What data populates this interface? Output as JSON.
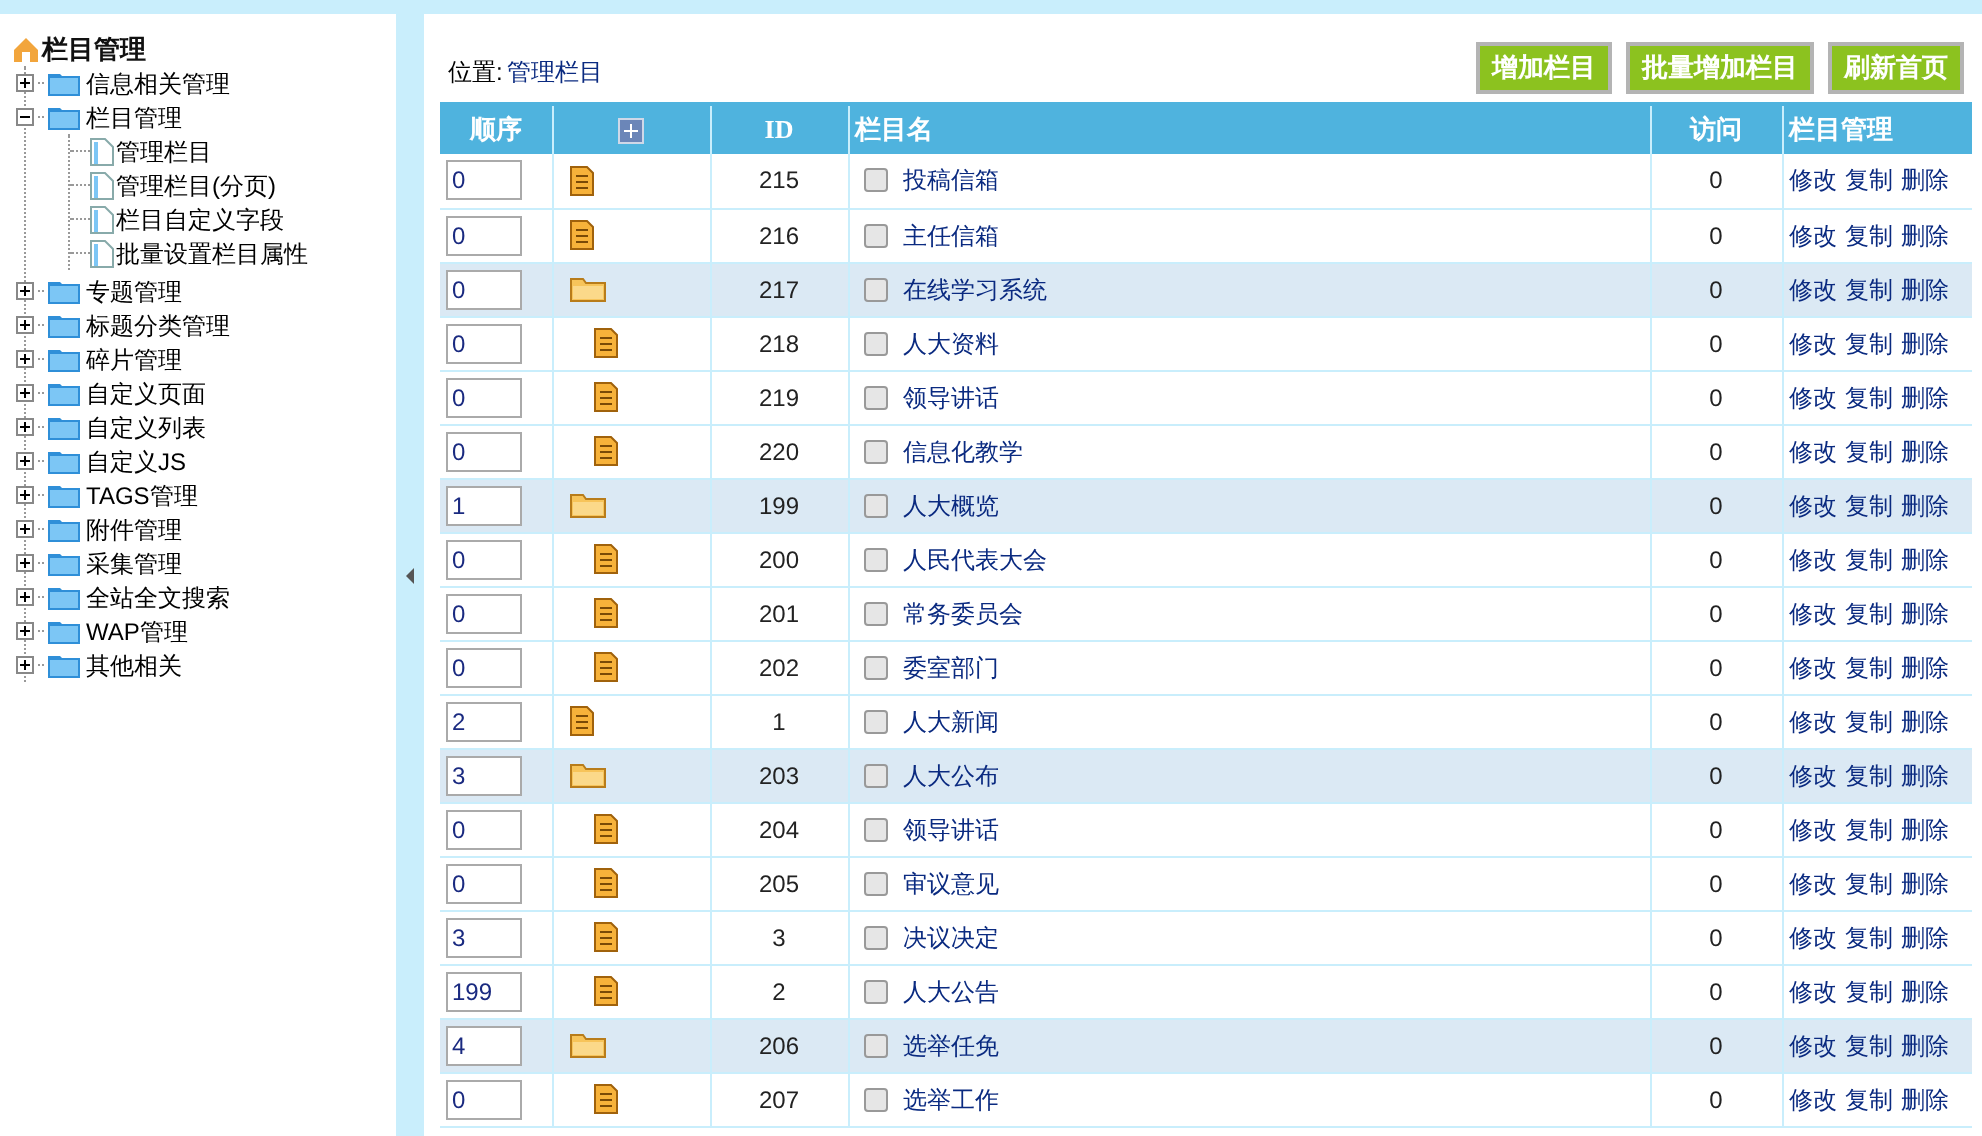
{
  "sidebar": {
    "title": "栏目管理",
    "items": [
      {
        "label": "信息相关管理",
        "expanded": false
      },
      {
        "label": "栏目管理",
        "expanded": true,
        "children": [
          {
            "label": "管理栏目"
          },
          {
            "label": "管理栏目(分页)"
          },
          {
            "label": "栏目自定义字段"
          },
          {
            "label": "批量设置栏目属性"
          }
        ]
      },
      {
        "label": "专题管理",
        "expanded": false
      },
      {
        "label": "标题分类管理",
        "expanded": false
      },
      {
        "label": "碎片管理",
        "expanded": false
      },
      {
        "label": "自定义页面",
        "expanded": false
      },
      {
        "label": "自定义列表",
        "expanded": false
      },
      {
        "label": "自定义JS",
        "expanded": false
      },
      {
        "label": "TAGS管理",
        "expanded": false
      },
      {
        "label": "附件管理",
        "expanded": false
      },
      {
        "label": "采集管理",
        "expanded": false
      },
      {
        "label": "全站全文搜索",
        "expanded": false
      },
      {
        "label": "WAP管理",
        "expanded": false
      },
      {
        "label": "其他相关",
        "expanded": false
      }
    ]
  },
  "location": {
    "label": "位置:",
    "link": "管理栏目"
  },
  "buttons": [
    "增加栏目",
    "批量增加栏目",
    "刷新首页"
  ],
  "table": {
    "columns": [
      "顺序",
      "ID",
      "栏目名",
      "访问",
      "栏目管理"
    ],
    "rows": [
      {
        "order": "0",
        "kind": "page",
        "id": "215",
        "name": "投稿信箱",
        "checked": false,
        "visits": "0",
        "actions": [
          "修改",
          "复制",
          "删除"
        ]
      },
      {
        "order": "0",
        "kind": "page",
        "id": "216",
        "name": "主任信箱",
        "checked": false,
        "visits": "0",
        "actions": [
          "修改",
          "复制",
          "删除"
        ]
      },
      {
        "order": "0",
        "kind": "folder",
        "id": "217",
        "name": "在线学习系统",
        "checked": false,
        "visits": "0",
        "actions": [
          "修改",
          "复制",
          "删除"
        ],
        "children": [
          {
            "order": "0",
            "kind": "page",
            "id": "218",
            "name": "人大资料",
            "checked": false,
            "visits": "0",
            "actions": [
              "修改",
              "复制",
              "删除"
            ]
          },
          {
            "order": "0",
            "kind": "page",
            "id": "219",
            "name": "领导讲话",
            "checked": false,
            "visits": "0",
            "actions": [
              "修改",
              "复制",
              "删除"
            ]
          },
          {
            "order": "0",
            "kind": "page",
            "id": "220",
            "name": "信息化教学",
            "checked": false,
            "visits": "0",
            "actions": [
              "修改",
              "复制",
              "删除"
            ]
          }
        ]
      },
      {
        "order": "1",
        "kind": "folder",
        "id": "199",
        "name": "人大概览",
        "checked": false,
        "visits": "0",
        "actions": [
          "修改",
          "复制",
          "删除"
        ],
        "children": [
          {
            "order": "0",
            "kind": "page",
            "id": "200",
            "name": "人民代表大会",
            "checked": false,
            "visits": "0",
            "actions": [
              "修改",
              "复制",
              "删除"
            ]
          },
          {
            "order": "0",
            "kind": "page",
            "id": "201",
            "name": "常务委员会",
            "checked": false,
            "visits": "0",
            "actions": [
              "修改",
              "复制",
              "删除"
            ]
          },
          {
            "order": "0",
            "kind": "page",
            "id": "202",
            "name": "委室部门",
            "checked": false,
            "visits": "0",
            "actions": [
              "修改",
              "复制",
              "删除"
            ]
          }
        ]
      },
      {
        "order": "2",
        "kind": "page",
        "id": "1",
        "name": "人大新闻",
        "checked": false,
        "visits": "0",
        "actions": [
          "修改",
          "复制",
          "删除"
        ]
      },
      {
        "order": "3",
        "kind": "folder",
        "id": "203",
        "name": "人大公布",
        "checked": false,
        "visits": "0",
        "actions": [
          "修改",
          "复制",
          "删除"
        ],
        "children": [
          {
            "order": "0",
            "kind": "page",
            "id": "204",
            "name": "领导讲话",
            "checked": false,
            "visits": "0",
            "actions": [
              "修改",
              "复制",
              "删除"
            ]
          },
          {
            "order": "0",
            "kind": "page",
            "id": "205",
            "name": "审议意见",
            "checked": false,
            "visits": "0",
            "actions": [
              "修改",
              "复制",
              "删除"
            ]
          },
          {
            "order": "3",
            "kind": "page",
            "id": "3",
            "name": "决议决定",
            "checked": false,
            "visits": "0",
            "actions": [
              "修改",
              "复制",
              "删除"
            ]
          },
          {
            "order": "199",
            "kind": "page",
            "id": "2",
            "name": "人大公告",
            "checked": false,
            "visits": "0",
            "actions": [
              "修改",
              "复制",
              "删除"
            ]
          }
        ]
      },
      {
        "order": "4",
        "kind": "folder",
        "id": "206",
        "name": "选举任免",
        "checked": false,
        "visits": "0",
        "actions": [
          "修改",
          "复制",
          "删除"
        ],
        "children": [
          {
            "order": "0",
            "kind": "page",
            "id": "207",
            "name": "选举工作",
            "checked": false,
            "visits": "0",
            "actions": [
              "修改",
              "复制",
              "删除"
            ]
          }
        ]
      }
    ]
  }
}
